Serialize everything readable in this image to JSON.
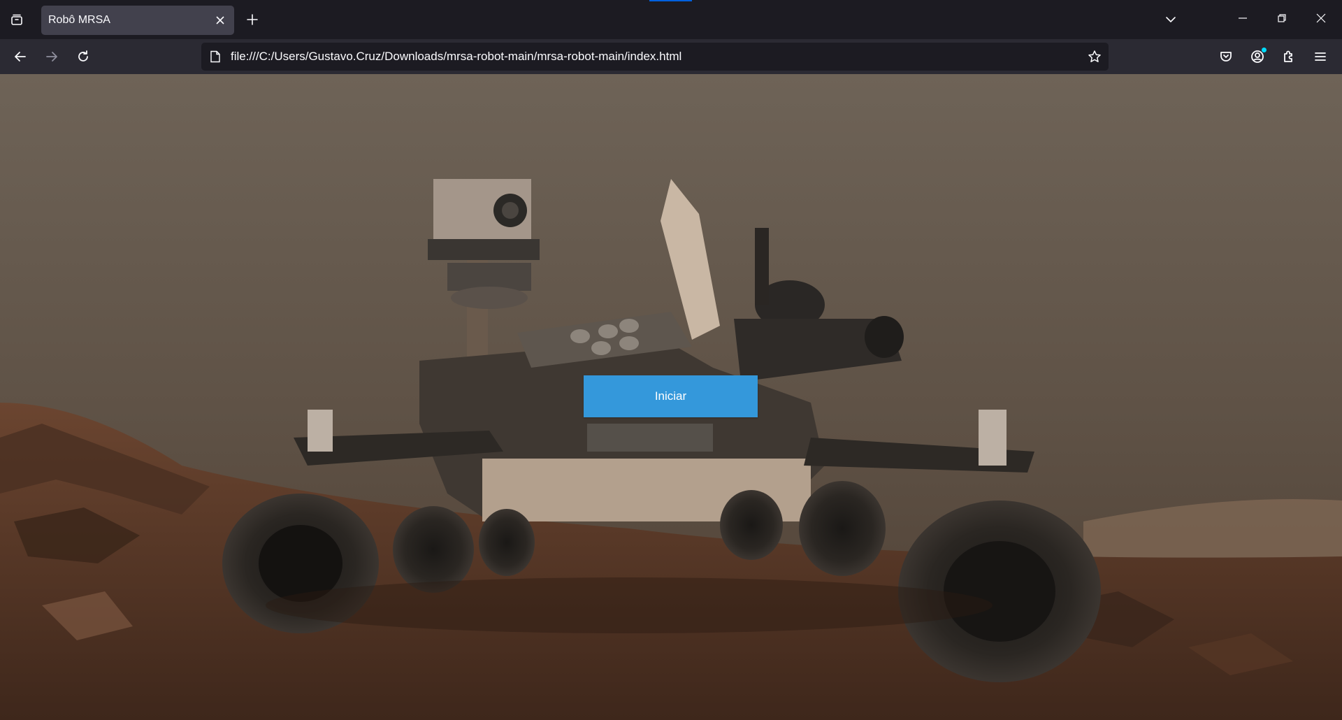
{
  "browser": {
    "tab": {
      "title": "Robô MRSA",
      "icon": "close-icon"
    },
    "address_bar": {
      "url": "file:///C:/Users/Gustavo.Cruz/Downloads/mrsa-robot-main/mrsa-robot-main/index.html"
    },
    "colors": {
      "tab_strip": "#1c1b22",
      "toolbar": "#2b2a33",
      "active_tab": "#42414d",
      "accent": "#0060df"
    }
  },
  "page": {
    "background": "photo of a Mars rover on reddish rocky terrain under a hazy sky",
    "start_button": {
      "label": "Iniciar",
      "color": "#3498db"
    }
  }
}
